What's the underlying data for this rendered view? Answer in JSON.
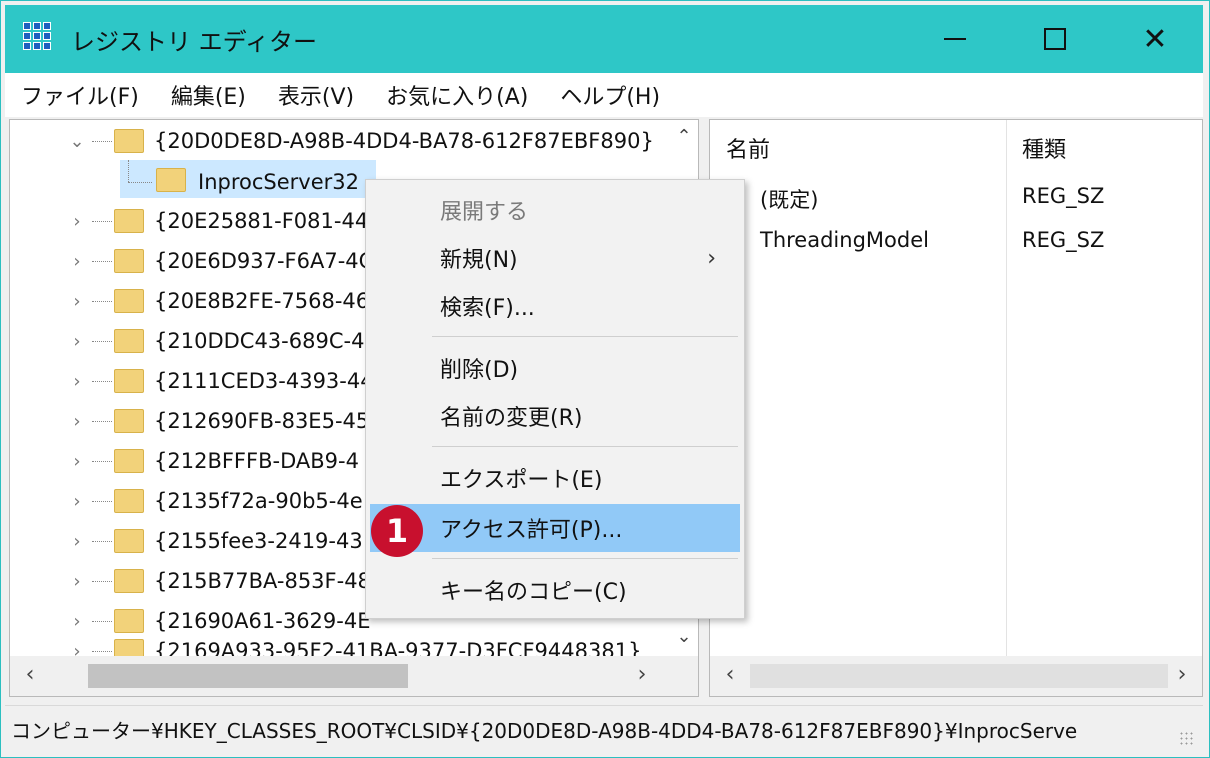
{
  "window": {
    "title": "レジストリ エディター",
    "minimize_glyph": "—",
    "close_glyph": "✕"
  },
  "menu": [
    "ファイル(F)",
    "編集(E)",
    "表示(V)",
    "お気に入り(A)",
    "ヘルプ(H)"
  ],
  "tree": {
    "expanded": "{20D0DE8D-A98B-4DD4-BA78-612F87EBF890}",
    "child": "InprocServer32",
    "siblings": [
      "{20E25881-F081-44",
      "{20E6D937-F6A7-4C",
      "{20E8B2FE-7568-46",
      "{210DDC43-689C-4",
      "{2111CED3-4393-44",
      "{212690FB-83E5-45",
      "{212BFFFB-DAB9-4",
      "{2135f72a-90b5-4e",
      "{2155fee3-2419-43",
      "{215B77BA-853F-48",
      "{21690A61-3629-4E",
      "{2169A933-95F2-41BA-9377-D3FCF9448381}"
    ]
  },
  "values_pane": {
    "columns": {
      "name": "名前",
      "type": "種類"
    },
    "rows": [
      {
        "name": "(既定)",
        "type": "REG_SZ"
      },
      {
        "name": "ThreadingModel",
        "type": "REG_SZ"
      }
    ]
  },
  "context_menu": {
    "items": [
      {
        "label": "展開する",
        "disabled": true
      },
      {
        "label": "新規(N)",
        "submenu": true
      },
      {
        "label": "検索(F)..."
      },
      {
        "label": "削除(D)"
      },
      {
        "label": "名前の変更(R)"
      },
      {
        "label": "エクスポート(E)"
      },
      {
        "label": "アクセス許可(P)...",
        "highlighted": true
      },
      {
        "label": "キー名のコピー(C)"
      }
    ],
    "submenu_glyph": "›",
    "highlight_color": "#91c9f7"
  },
  "annotation": {
    "badge": "1",
    "color": "#c8102e"
  },
  "status_bar": {
    "path": "コンピューター¥HKEY_CLASSES_ROOT¥CLSID¥{20D0DE8D-A98B-4DD4-BA78-612F87EBF890}¥InprocServe"
  },
  "colors": {
    "titlebar": "#2ec7c7",
    "folder": "#f2d27a"
  }
}
